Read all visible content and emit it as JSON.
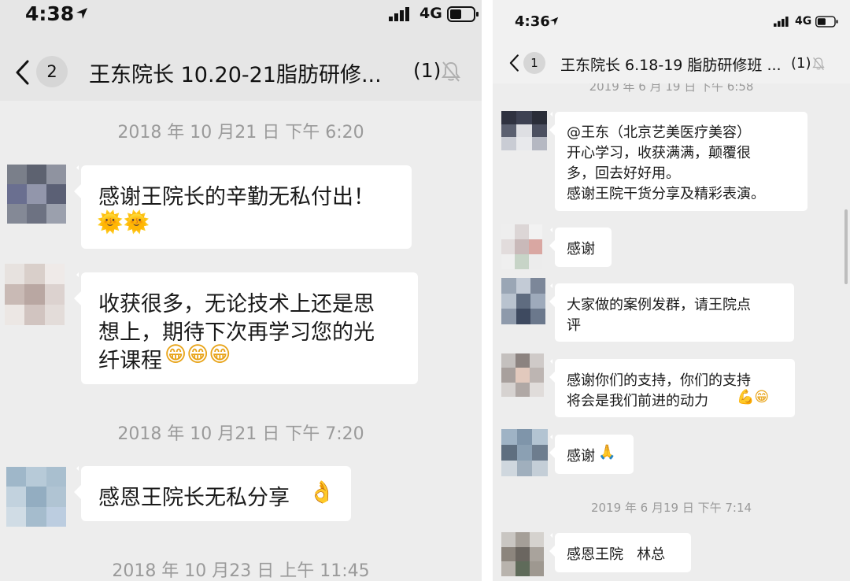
{
  "left": {
    "status": {
      "time": "4:38",
      "network": "4G"
    },
    "header": {
      "unread_count": "2",
      "title": "王东院长 10.20-21脂肪研修...",
      "member_count": "(1)"
    },
    "messages": [
      {
        "stamp": "2018 年 10 月21 日  下午 6:20"
      },
      {
        "text": "感谢王院长的辛勤无私付出！",
        "emoji": "🌞🌞"
      },
      {
        "lines": [
          "收获很多，无论技术上还是思",
          "想上，期待下次再学习您的光",
          "纤课程"
        ],
        "emoji": "😁😁😁"
      },
      {
        "stamp": "2018 年 10 月21 日  下午 7:20"
      },
      {
        "text": "感恩王院长无私分享",
        "emoji": "👌"
      },
      {
        "stamp": "2018 年 10 月23 日  上午 11:45"
      }
    ]
  },
  "right": {
    "status": {
      "time": "4:36",
      "network": "4G"
    },
    "header": {
      "unread_count": "1",
      "title": "王东院长 6.18-19 脂肪研修班 ...",
      "member_count": "(1)"
    },
    "top_stamp": "2019 年 6 月 19 日  下午 6:58",
    "messages": [
      {
        "lines": [
          "@王东（北京艺美医疗美容）",
          "开心学习，收获满满，颠覆很",
          "多，回去好好用。",
          "感谢王院干货分享及精彩表演。"
        ]
      },
      {
        "lines": [
          "感谢"
        ]
      },
      {
        "lines": [
          "大家做的案例发群，请王院点",
          "评"
        ]
      },
      {
        "lines": [
          "感谢你们的支持，你们的支持",
          "将会是我们前进的动力"
        ],
        "emoji": "💪😁"
      },
      {
        "lines": [
          "感谢"
        ],
        "emoji": "🙏"
      },
      {
        "stamp": "2019 年 6 月19 日  下午 7:14"
      },
      {
        "lines": [
          "感恩王院   林总"
        ]
      }
    ]
  },
  "colors": {
    "background": "#ededed",
    "header": "#e6e6e6",
    "bubble": "#ffffff",
    "timestamp": "#9a9a9a"
  }
}
